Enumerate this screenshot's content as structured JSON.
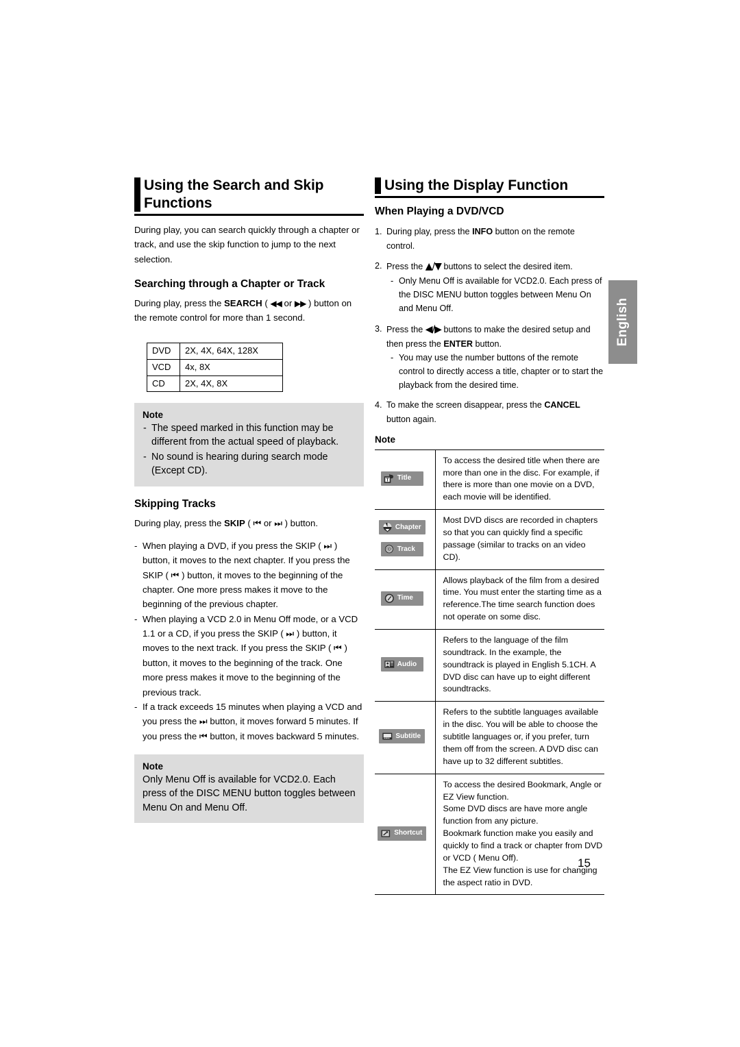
{
  "page": {
    "number": "15",
    "language_tab": "English"
  },
  "left_column": {
    "heading": "Using the Search and Skip Functions",
    "intro": "During play, you can search quickly through a chapter or track, and use the skip function to jump to the next selection.",
    "searching": {
      "heading": "Searching through a Chapter or Track",
      "paragraph_pre": "During play, press the ",
      "paragraph_bold": "SEARCH",
      "paragraph_mid": " ( ",
      "glyph_rew": "◀◀",
      "paragraph_or": " or  ",
      "glyph_ff": "▶▶",
      "paragraph_post": " ) button on the remote control for more than 1 second."
    },
    "speed_table": {
      "rows": [
        {
          "disc": "DVD",
          "speeds": "2X, 4X, 64X, 128X"
        },
        {
          "disc": "VCD",
          "speeds": "4x, 8X"
        },
        {
          "disc": "CD",
          "speeds": "2X, 4X, 8X"
        }
      ]
    },
    "note_one": {
      "title": "Note",
      "items": [
        "The speed marked in this function may be different from the actual speed of playback.",
        "No sound is hearing during search mode (Except CD)."
      ]
    },
    "skipping": {
      "heading": "Skipping Tracks",
      "intro_pre": "During play, press the ",
      "intro_bold": "SKIP",
      "intro_mid": " ( ",
      "glyph_skip_back": "⏮",
      "intro_or": "  or  ",
      "glyph_skip_fwd": "⏭",
      "intro_post": " ) button.",
      "bullets": [
        "When playing a DVD, if you press the SKIP ( ⏭ ) button, it moves to the next chapter. If you press the SKIP ( ⏮ ) button, it moves to the beginning of the chapter. One more press makes it move to the beginning of the previous chapter.",
        "When playing a VCD 2.0 in Menu Off mode, or a VCD 1.1 or a CD, if you press the SKIP ( ⏭ ) button, it moves to the next track. If you press the SKIP ( ⏮ ) button, it moves to the beginning of the track. One more press makes it move to the beginning of the previous track.",
        "If a track exceeds 15 minutes when playing a VCD and you press the ⏭ button, it moves forward 5 minutes. If you press the ⏮ button, it moves backward 5 minutes."
      ]
    },
    "note_two": {
      "title": "Note",
      "text": "Only Menu Off is available for VCD2.0. Each press of the DISC MENU button toggles between Menu On and Menu Off."
    }
  },
  "right_column": {
    "heading": "Using the Display Function",
    "sub_heading": "When Playing a DVD/VCD",
    "steps": [
      {
        "text_pre": "During play, press the ",
        "bold": "INFO",
        "text_post": " button on the remote control.",
        "sub": []
      },
      {
        "text_pre": "Press the ",
        "glyph": "▲/▼",
        "text_post": " buttons to select the desired item.",
        "sub": [
          "Only Menu Off is available for VCD2.0. Each press of the DISC MENU button toggles between Menu On and Menu Off."
        ]
      },
      {
        "text_pre": "Press the ",
        "glyph": "◀/▶",
        "text_mid": " buttons to make the desired setup and then press the ",
        "bold": "ENTER",
        "text_post": " button.",
        "sub": [
          "You may use the number buttons of the remote control to directly access a title, chapter or to start the playback from the desired time."
        ]
      },
      {
        "text_pre": "To make the screen disappear, press the ",
        "bold": "CANCEL",
        "text_post": " button again.",
        "sub": []
      }
    ],
    "note_title": "Note",
    "icon_table": [
      {
        "icons": [
          {
            "name": "title-icon",
            "label": "Title"
          }
        ],
        "description": "To access the desired title when there are more than one in the disc. For example, if there is more than one movie on a DVD, each movie will be identified."
      },
      {
        "icons": [
          {
            "name": "chapter-icon",
            "label": "Chapter"
          },
          {
            "name": "track-icon",
            "label": "Track"
          }
        ],
        "description": "Most DVD discs are recorded in chapters so that you can quickly find a specific passage (similar to tracks on an video CD)."
      },
      {
        "icons": [
          {
            "name": "time-icon",
            "label": "Time"
          }
        ],
        "description": "Allows playback of the film from a desired time. You must enter the starting time as a reference.The time search function does not operate on some disc."
      },
      {
        "icons": [
          {
            "name": "audio-icon",
            "label": "Audio"
          }
        ],
        "description": "Refers to the language of the film soundtrack. In the example, the soundtrack is played in English 5.1CH. A DVD disc can have up to eight different soundtracks."
      },
      {
        "icons": [
          {
            "name": "subtitle-icon",
            "label": "Subtitle"
          }
        ],
        "description": "Refers to the subtitle languages available in the disc. You will be able to choose the subtitle languages or, if you prefer, turn them off from the screen. A DVD disc can have up to 32 different subtitles."
      },
      {
        "icons": [
          {
            "name": "shortcut-icon",
            "label": "Shortcut"
          }
        ],
        "description": "To access the desired Bookmark, Angle  or EZ View function.\nSome DVD discs are have more angle function from any picture.\nBookmark function make you easily and quickly to find a track or chapter from DVD or VCD ( Menu Off).\nThe EZ View function is use for changing the aspect ratio in DVD."
      }
    ]
  },
  "colors": {
    "note_background": "#dcdcdc",
    "badge_background": "#8d8d8d",
    "tab_background": "#8d8d8d",
    "text": "#000000"
  }
}
